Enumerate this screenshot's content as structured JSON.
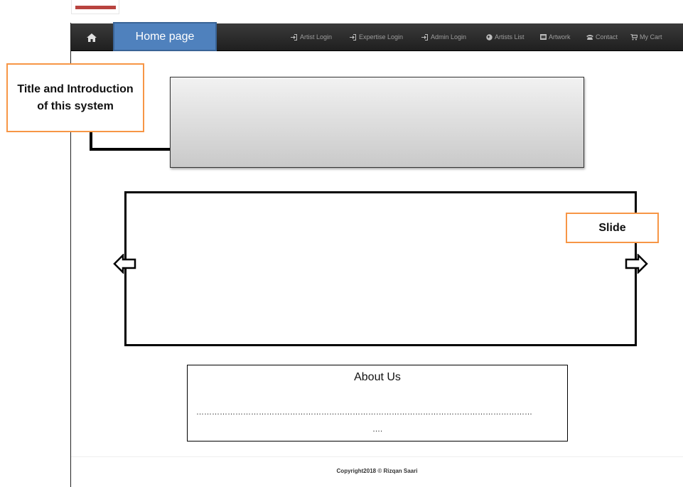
{
  "navbar": {
    "homepage_label": "Home page",
    "items": [
      {
        "label": "Artist Login",
        "icon": "login-icon"
      },
      {
        "label": "Expertise Login",
        "icon": "login-icon"
      },
      {
        "label": "Admin Login",
        "icon": "login-icon"
      },
      {
        "label": "Artists List",
        "icon": "globe-icon"
      },
      {
        "label": "Artwork",
        "icon": "picture-icon"
      },
      {
        "label": "Contact",
        "icon": "phone-icon"
      },
      {
        "label": "My Cart",
        "icon": "cart-icon"
      }
    ]
  },
  "annotations": {
    "title_callout": "Title and Introduction of this system",
    "slide_callout": "Slide"
  },
  "about": {
    "title": "About Us",
    "dots_line1": "…………………………………………………………………………………………………………………",
    "dots_line2": "…."
  },
  "footer": {
    "copyright": "Copyright2018 © Rizqan Saari"
  },
  "colors": {
    "navbar": "#222222",
    "homepage_label_bg": "#4f81bd",
    "callout_border": "#f79646",
    "top_mark": "#b8433f"
  }
}
